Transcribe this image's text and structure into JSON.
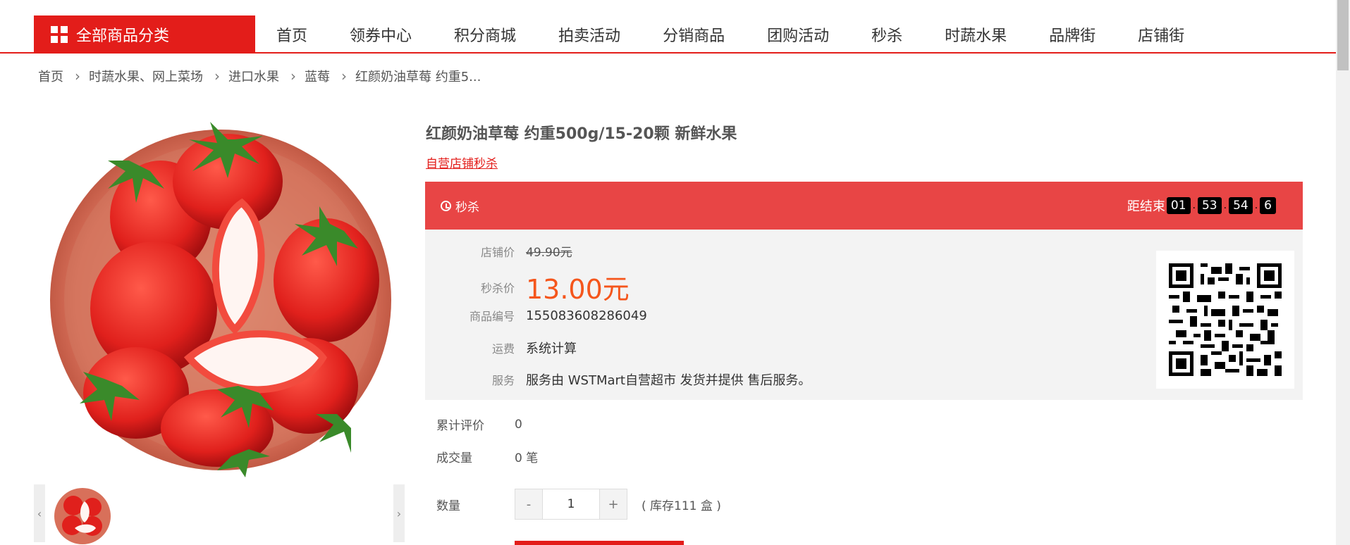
{
  "nav": {
    "all_categories": "全部商品分类",
    "items": [
      "首页",
      "领券中心",
      "积分商城",
      "拍卖活动",
      "分销商品",
      "团购活动",
      "秒杀",
      "时蔬水果",
      "品牌街",
      "店铺街"
    ]
  },
  "breadcrumb": [
    "首页",
    "时蔬水果、网上菜场",
    "进口水果",
    "蓝莓",
    "红颜奶油草莓 约重5..."
  ],
  "product": {
    "title": "红颜奶油草莓 约重500g/15-20颗 新鲜水果",
    "subtitle": "自营店铺秒杀"
  },
  "flash": {
    "label": "秒杀",
    "ends_in_label": "距结束",
    "hours": "01",
    "minutes": "53",
    "seconds": "54",
    "tenths": "6"
  },
  "price": {
    "shop_price_label": "店铺价",
    "shop_price": "49.90元",
    "flash_price_label": "秒杀价",
    "flash_price": "13.00元",
    "sku_label": "商品编号",
    "sku": "155083608286049",
    "shipping_label": "运费",
    "shipping": "系统计算",
    "service_label": "服务",
    "service": "服务由 WSTMart自营超市 发货并提供 售后服务。"
  },
  "stats": {
    "reviews_label": "累计评价",
    "reviews": "0",
    "sales_label": "成交量",
    "sales": "0 笔"
  },
  "quantity": {
    "label": "数量",
    "minus": "-",
    "plus": "+",
    "value": "1",
    "stock": "( 库存111 盒 )"
  },
  "colors": {
    "brand_red": "#e31d1a",
    "flash_bar": "#e84545",
    "price_orange": "#f5561c"
  }
}
